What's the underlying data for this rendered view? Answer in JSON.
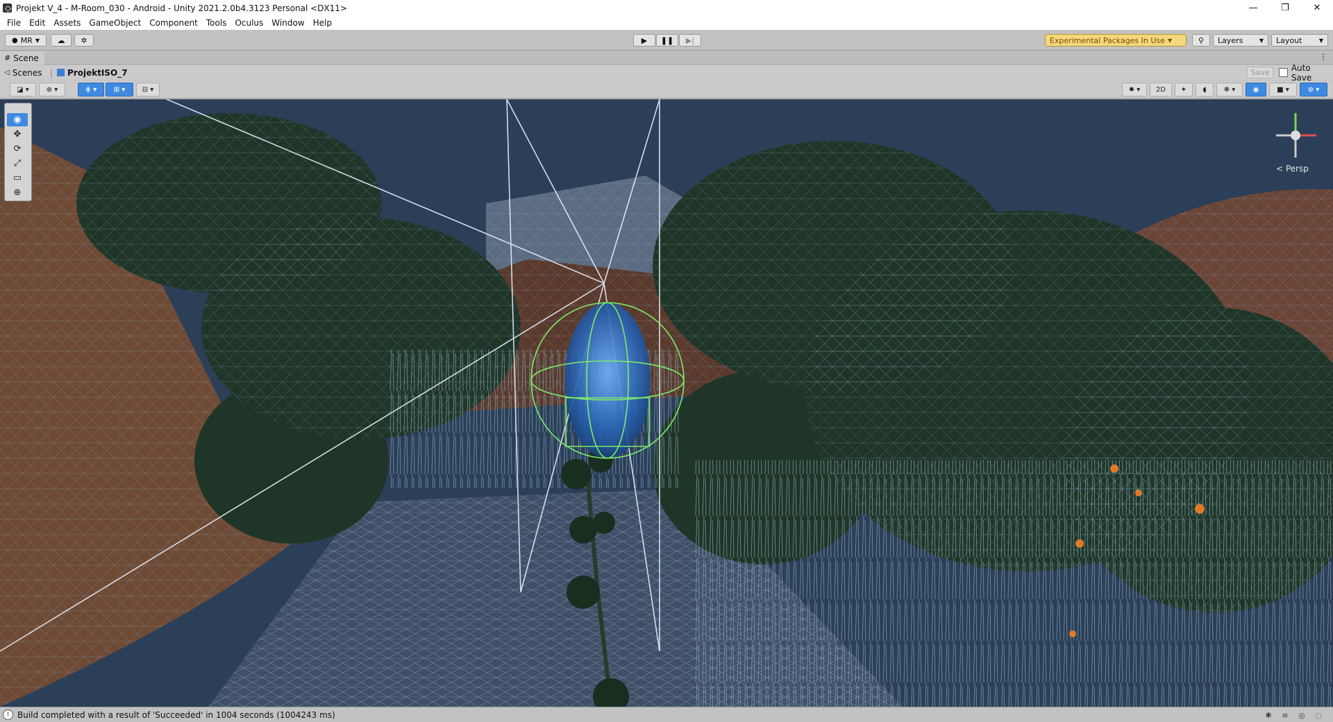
{
  "window": {
    "title": "Projekt V_4 - M-Room_030 - Android - Unity 2021.2.0b4.3123 Personal <DX11>",
    "minimize": "—",
    "maximize": "❐",
    "close": "✕"
  },
  "menu": [
    "File",
    "Edit",
    "Assets",
    "GameObject",
    "Component",
    "Tools",
    "Oculus",
    "Window",
    "Help"
  ],
  "toolbar": {
    "account": "MR",
    "experimental": "Experimental Packages In Use",
    "layers": "Layers",
    "layout": "Layout"
  },
  "scene_tab": {
    "label": "Scene"
  },
  "breadcrumb": {
    "root": "Scenes",
    "current": "ProjektISO_7",
    "save": "Save",
    "autosave": "Auto Save"
  },
  "scene_toolbar": {
    "mode_2d": "2D"
  },
  "gizmo": {
    "projection": "< Persp"
  },
  "status": {
    "message": "Build completed with a result of 'Succeeded' in 1004 seconds (1004243 ms)"
  }
}
